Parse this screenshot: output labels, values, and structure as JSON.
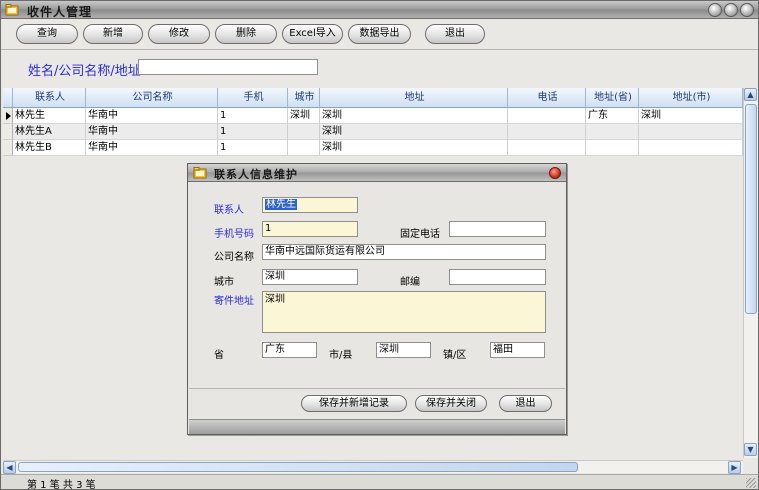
{
  "window": {
    "title": "收件人管理"
  },
  "toolbar": {
    "buttons": [
      "查询",
      "新增",
      "修改",
      "删除",
      "Excel导入",
      "数据导出",
      "退出"
    ]
  },
  "search": {
    "label": "姓名/公司名称/地址",
    "value": ""
  },
  "grid": {
    "columns": [
      "联系人",
      "公司名称",
      "手机",
      "城市",
      "地址",
      "电话",
      "地址(省)",
      "地址(市)"
    ],
    "rows": [
      [
        "林先生",
        "华南中",
        "1",
        "深圳",
        "深圳",
        "",
        "广东",
        "深圳"
      ],
      [
        "林先生A",
        "华南中",
        "1",
        "",
        "深圳",
        "",
        "",
        ""
      ],
      [
        "林先生B",
        "华南中",
        "1",
        "",
        "深圳",
        "",
        "",
        ""
      ]
    ]
  },
  "status": {
    "text": "第 1 笔  共 3 笔"
  },
  "dialog": {
    "title": "联系人信息维护",
    "contact": {
      "label": "联系人",
      "value": "林先生"
    },
    "mobile": {
      "label": "手机号码",
      "value": "1"
    },
    "phone": {
      "label": "固定电话",
      "value": ""
    },
    "company": {
      "label": "公司名称",
      "value": "华南中远国际货运有限公司"
    },
    "city": {
      "label": "城市",
      "value": "深圳"
    },
    "postcode": {
      "label": "邮编",
      "value": ""
    },
    "address": {
      "label": "寄件地址",
      "value": "深圳"
    },
    "province": {
      "label": "省",
      "value": "广东"
    },
    "county": {
      "label": "市/县",
      "value": "深圳"
    },
    "town": {
      "label": "镇/区",
      "value": "福田"
    },
    "buttons": {
      "save_new": "保存并新增记录",
      "save_close": "保存并关闭",
      "exit": "退出"
    }
  },
  "colors": {
    "accent_text": "#2b2be0",
    "header_blue": "#cfe0f2",
    "required_bg": "#fbf6d6",
    "selection": "#2d62c8"
  },
  "icons": {
    "app": "folder-icon",
    "dialog": "folder-icon",
    "close": "close-icon"
  }
}
